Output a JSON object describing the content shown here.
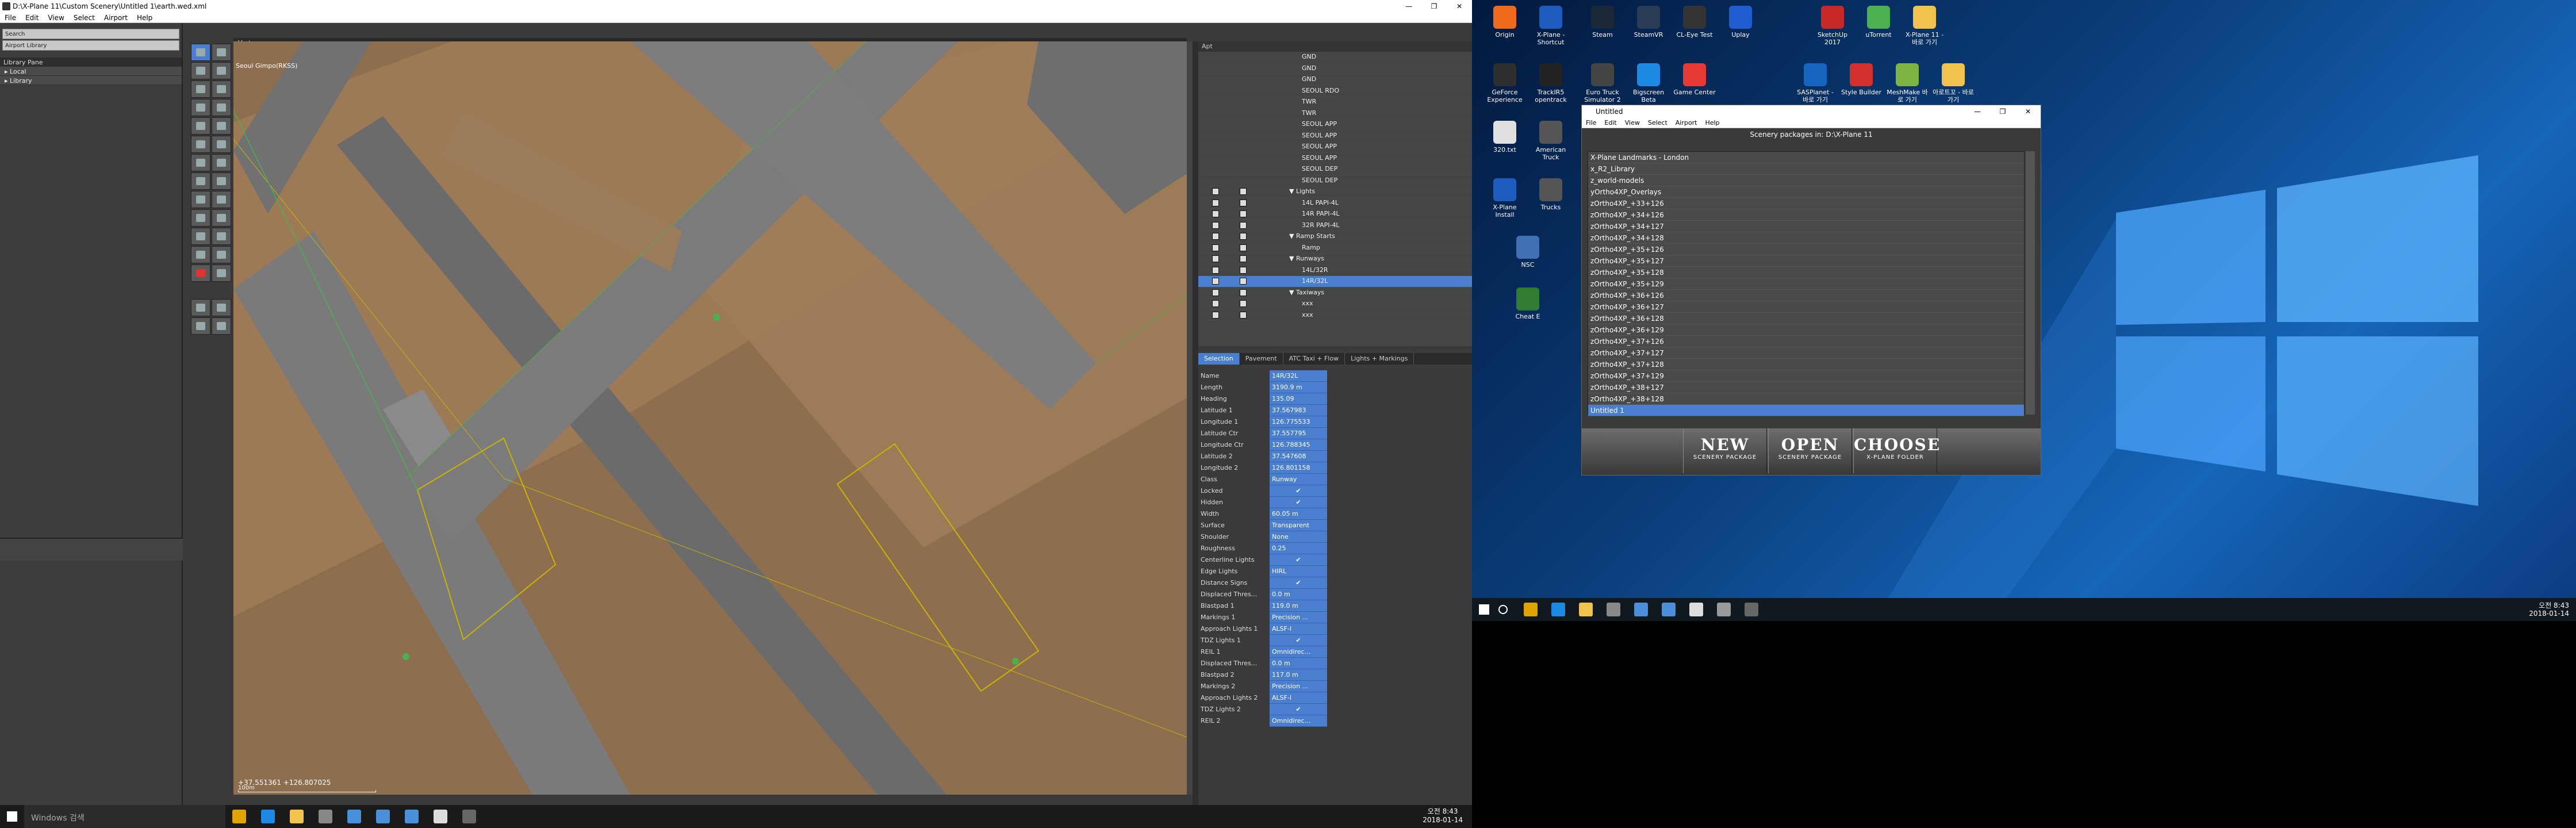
{
  "wed": {
    "title": "D:\\X-Plane 11\\Custom Scenery\\Untitled 1\\earth.wed.xml",
    "menu": [
      "File",
      "Edit",
      "View",
      "Select",
      "Airport",
      "Help"
    ],
    "win_controls": [
      "—",
      "❐",
      "✕"
    ],
    "library": {
      "search_placeholder": "Search",
      "filter_label": "Airport Library",
      "header": "Library Pane",
      "items": [
        "Local",
        "Library"
      ]
    },
    "map": {
      "view_label": "Vertex",
      "airport_label": "Seoul Gimpo(RKSS)",
      "coords": "+37.551361 +126.807025",
      "scale_label": "100m"
    },
    "tree": {
      "header": "Apt",
      "rows": [
        {
          "label": "GND",
          "indent": 3,
          "checks": false,
          "selected": false
        },
        {
          "label": "GND",
          "indent": 3,
          "checks": false,
          "selected": false
        },
        {
          "label": "GND",
          "indent": 3,
          "checks": false,
          "selected": false
        },
        {
          "label": "SEOUL RDO",
          "indent": 3,
          "checks": false,
          "selected": false
        },
        {
          "label": "TWR",
          "indent": 3,
          "checks": false,
          "selected": false
        },
        {
          "label": "TWR",
          "indent": 3,
          "checks": false,
          "selected": false
        },
        {
          "label": "SEOUL APP",
          "indent": 3,
          "checks": false,
          "selected": false
        },
        {
          "label": "SEOUL APP",
          "indent": 3,
          "checks": false,
          "selected": false
        },
        {
          "label": "SEOUL APP",
          "indent": 3,
          "checks": false,
          "selected": false
        },
        {
          "label": "SEOUL APP",
          "indent": 3,
          "checks": false,
          "selected": false
        },
        {
          "label": "SEOUL DEP",
          "indent": 3,
          "checks": false,
          "selected": false
        },
        {
          "label": "SEOUL DEP",
          "indent": 3,
          "checks": false,
          "selected": false
        },
        {
          "label": "▼ Lights",
          "indent": 2,
          "checks": true,
          "selected": false
        },
        {
          "label": "14L PAPI-4L",
          "indent": 3,
          "checks": true,
          "selected": false
        },
        {
          "label": "14R PAPI-4L",
          "indent": 3,
          "checks": true,
          "selected": false
        },
        {
          "label": "32R PAPI-4L",
          "indent": 3,
          "checks": true,
          "selected": false
        },
        {
          "label": "▼ Ramp Starts",
          "indent": 2,
          "checks": true,
          "selected": false
        },
        {
          "label": "Ramp",
          "indent": 3,
          "checks": true,
          "selected": false
        },
        {
          "label": "▼ Runways",
          "indent": 2,
          "checks": true,
          "selected": false
        },
        {
          "label": "14L/32R",
          "indent": 3,
          "checks": true,
          "selected": false
        },
        {
          "label": "14R/32L",
          "indent": 3,
          "checks": true,
          "selected": true
        },
        {
          "label": "▼ Taxiways",
          "indent": 2,
          "checks": true,
          "selected": false
        },
        {
          "label": "xxx",
          "indent": 3,
          "checks": true,
          "selected": false
        },
        {
          "label": "xxx",
          "indent": 3,
          "checks": true,
          "selected": false
        }
      ]
    },
    "tabs": [
      "Selection",
      "Pavement",
      "ATC Taxi + Flow",
      "Lights + Markings"
    ],
    "props": [
      {
        "n": "Name",
        "v": "14R/32L"
      },
      {
        "n": "Length",
        "v": "3190.9 m"
      },
      {
        "n": "Heading",
        "v": "135.09"
      },
      {
        "n": "Latitude 1",
        "v": "37.567983"
      },
      {
        "n": "Longitude 1",
        "v": "126.775533"
      },
      {
        "n": "Latitude Ctr",
        "v": "37.557795"
      },
      {
        "n": "Longitude Ctr",
        "v": "126.788345"
      },
      {
        "n": "Latitude 2",
        "v": "37.547608"
      },
      {
        "n": "Longitude 2",
        "v": "126.801158"
      },
      {
        "n": "Class",
        "v": "Runway"
      },
      {
        "n": "Locked",
        "v": "✔"
      },
      {
        "n": "Hidden",
        "v": "✔"
      },
      {
        "n": "Width",
        "v": "60.05 m"
      },
      {
        "n": "Surface",
        "v": "Transparent"
      },
      {
        "n": "Shoulder",
        "v": "None"
      },
      {
        "n": "Roughness",
        "v": "0.25"
      },
      {
        "n": "Centerline Lights",
        "v": "✔"
      },
      {
        "n": "Edge Lights",
        "v": "HIRL"
      },
      {
        "n": "Distance Signs",
        "v": "✔"
      },
      {
        "n": "Displaced Thres...",
        "v": "0.0 m"
      },
      {
        "n": "Blastpad 1",
        "v": "119.0 m"
      },
      {
        "n": "Markings 1",
        "v": "Precision ..."
      },
      {
        "n": "Approach Lights 1",
        "v": "ALSF-I"
      },
      {
        "n": "TDZ Lights 1",
        "v": "✔"
      },
      {
        "n": "REIL 1",
        "v": "Omnidirec..."
      },
      {
        "n": "Displaced Thres...",
        "v": "0.0 m"
      },
      {
        "n": "Blastpad 2",
        "v": "117.0 m"
      },
      {
        "n": "Markings 2",
        "v": "Precision ..."
      },
      {
        "n": "Approach Lights 2",
        "v": "ALSF-I"
      },
      {
        "n": "TDZ Lights 2",
        "v": "✔"
      },
      {
        "n": "REIL 2",
        "v": "Omnidirec..."
      }
    ]
  },
  "taskbar": {
    "search_text": "Windows 검색",
    "clock_time": "오전 8:43",
    "clock_date": "2018-01-14"
  },
  "desktop": {
    "icons": [
      {
        "label": "Origin",
        "color": "#f06a1e"
      },
      {
        "label": "X-Plane - Shortcut",
        "color": "#1e5bbf"
      },
      {
        "label": "Steam",
        "color": "#1b2838"
      },
      {
        "label": "SteamVR",
        "color": "#2a3b57"
      },
      {
        "label": "CL-Eye Test",
        "color": "#333333"
      },
      {
        "label": "Uplay",
        "color": "#1f5cd1"
      },
      {
        "label": "SketchUp 2017",
        "color": "#c62828"
      },
      {
        "label": "uTorrent",
        "color": "#4caf50"
      },
      {
        "label": "X-Plane 11 - 바로 가기",
        "color": "#f2c24f"
      },
      {
        "label": "GeForce Experience",
        "color": "#2e2e2e"
      },
      {
        "label": "TrackIR5 opentrack",
        "color": "#222222"
      },
      {
        "label": "Euro Truck Simulator 2",
        "color": "#444444"
      },
      {
        "label": "Bigscreen Beta",
        "color": "#1e88e5"
      },
      {
        "label": "Game Center",
        "color": "#e53935"
      },
      {
        "label": "SASPlanet - 바로 가기",
        "color": "#1565c0"
      },
      {
        "label": "Style Builder",
        "color": "#d32f2f"
      },
      {
        "label": "MeshMake 바로 가기",
        "color": "#7cb342"
      },
      {
        "label": "아로트꼬 - 바로 가기",
        "color": "#f2c24f"
      },
      {
        "label": "320.txt",
        "color": "#e0e0e0"
      },
      {
        "label": "American Truck",
        "color": "#555555"
      },
      {
        "label": "X-Plane Install",
        "color": "#1e5bbf"
      },
      {
        "label": "Trucks",
        "color": "#555555"
      },
      {
        "label": "NSC",
        "color": "#3f6fb5"
      },
      {
        "label": "Cheat E",
        "color": "#2e7d32"
      }
    ],
    "clock_time": "오전 8:43",
    "clock_date": "2018-01-14"
  },
  "scenery": {
    "title": "Untitled",
    "menu": [
      "File",
      "Edit",
      "View",
      "Select",
      "Airport",
      "Help"
    ],
    "win_controls": [
      "—",
      "❐",
      "✕"
    ],
    "header": "Scenery packages in: D:\\X-Plane 11",
    "packages": [
      "X-Plane Landmarks - London",
      "x_R2_Library",
      "z_world-models",
      "yOrtho4XP_Overlays",
      "zOrtho4XP_+33+126",
      "zOrtho4XP_+34+126",
      "zOrtho4XP_+34+127",
      "zOrtho4XP_+34+128",
      "zOrtho4XP_+35+126",
      "zOrtho4XP_+35+127",
      "zOrtho4XP_+35+128",
      "zOrtho4XP_+35+129",
      "zOrtho4XP_+36+126",
      "zOrtho4XP_+36+127",
      "zOrtho4XP_+36+128",
      "zOrtho4XP_+36+129",
      "zOrtho4XP_+37+126",
      "zOrtho4XP_+37+127",
      "zOrtho4XP_+37+128",
      "zOrtho4XP_+37+129",
      "zOrtho4XP_+38+127",
      "zOrtho4XP_+38+128",
      "Untitled 1"
    ],
    "selected_index": 22,
    "buttons": [
      {
        "big": "NEW",
        "small": "SCENERY PACKAGE"
      },
      {
        "big": "OPEN",
        "small": "SCENERY PACKAGE"
      },
      {
        "big": "CHOOSE",
        "small": "X-PLANE FOLDER"
      }
    ]
  }
}
